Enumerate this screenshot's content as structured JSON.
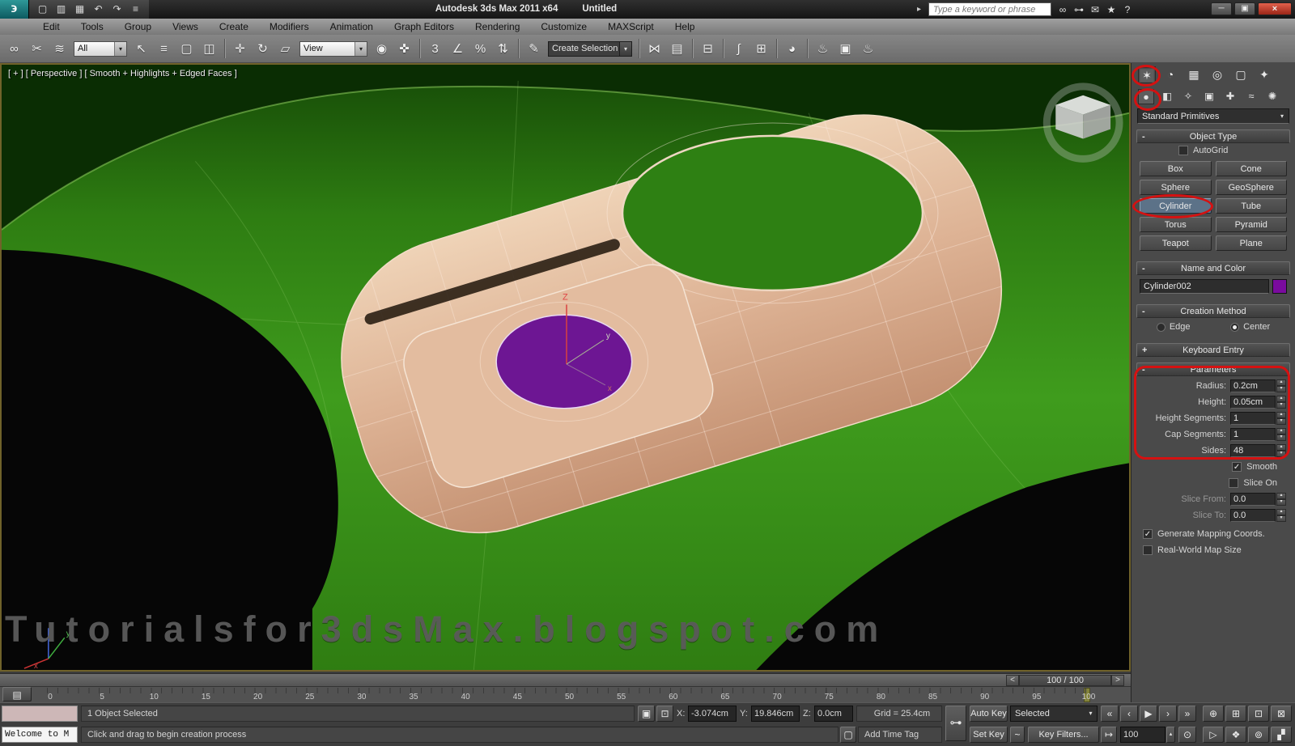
{
  "title_bar": {
    "logo_glyph": "϶",
    "app_title": "Autodesk 3ds Max  2011 x64",
    "document_title": "Untitled",
    "quick_access": [
      {
        "name": "new-scene-icon",
        "glyph": "▢"
      },
      {
        "name": "open-file-icon",
        "glyph": "▥"
      },
      {
        "name": "save-file-icon",
        "glyph": "▦"
      },
      {
        "name": "undo-icon",
        "glyph": "↶"
      },
      {
        "name": "redo-icon",
        "glyph": "↷"
      },
      {
        "name": "project-folder-icon",
        "glyph": "≡"
      }
    ],
    "search": {
      "placeholder": "Type a keyword or phrase"
    },
    "infocenter_icons": [
      {
        "name": "search-binoculars-icon",
        "glyph": "∞"
      },
      {
        "name": "subscription-key-icon",
        "glyph": "⊶"
      },
      {
        "name": "communication-center-icon",
        "glyph": "✉"
      },
      {
        "name": "favorites-star-icon",
        "glyph": "★"
      },
      {
        "name": "help-icon",
        "glyph": "?"
      }
    ],
    "window_buttons": [
      {
        "name": "minimize-button",
        "glyph": "─"
      },
      {
        "name": "restore-button",
        "glyph": "▣"
      },
      {
        "name": "close-button",
        "glyph": "×"
      }
    ]
  },
  "menu_bar": {
    "items": [
      "Edit",
      "Tools",
      "Group",
      "Views",
      "Create",
      "Modifiers",
      "Animation",
      "Graph Editors",
      "Rendering",
      "Customize",
      "MAXScript",
      "Help"
    ]
  },
  "toolbar": {
    "items": [
      {
        "name": "select-and-link-icon",
        "glyph": "∞"
      },
      {
        "name": "unlink-selection-icon",
        "glyph": "✂"
      },
      {
        "name": "bind-to-space-warp-icon",
        "glyph": "≋"
      },
      {
        "name": "selection-filter-dropdown",
        "value": "All",
        "w": "w66"
      },
      {
        "name": "select-object-icon",
        "glyph": "↖"
      },
      {
        "name": "select-by-name-icon",
        "glyph": "≡"
      },
      {
        "name": "rectangular-selection-region-icon",
        "glyph": "▢"
      },
      {
        "name": "window-crossing-icon",
        "glyph": "◫"
      },
      {
        "name": "toolbar-separator",
        "sep": true
      },
      {
        "name": "select-and-move-icon",
        "glyph": "✛"
      },
      {
        "name": "select-and-rotate-icon",
        "glyph": "↻"
      },
      {
        "name": "select-and-scale-icon",
        "glyph": "▱"
      },
      {
        "name": "reference-coordinate-dropdown",
        "value": "View",
        "w": "w84"
      },
      {
        "name": "use-pivot-point-center-icon",
        "glyph": "◉"
      },
      {
        "name": "select-and-manipulate-icon",
        "glyph": "✜"
      },
      {
        "name": "toolbar-separator",
        "sep": true
      },
      {
        "name": "snaps-toggle-icon",
        "glyph": "3"
      },
      {
        "name": "angle-snap-icon",
        "glyph": "∠"
      },
      {
        "name": "percent-snap-icon",
        "glyph": "%"
      },
      {
        "name": "spinner-snap-icon",
        "glyph": "⇅"
      },
      {
        "name": "toolbar-separator",
        "sep": true
      },
      {
        "name": "edit-named-selection-sets-icon",
        "glyph": "✎"
      },
      {
        "name": "named-selection-set-dropdown",
        "value": "Create Selection Se",
        "dark": true
      },
      {
        "name": "toolbar-separator",
        "sep": true
      },
      {
        "name": "mirror-icon",
        "glyph": "⋈"
      },
      {
        "name": "align-icon",
        "glyph": "▤"
      },
      {
        "name": "toolbar-separator",
        "sep": true
      },
      {
        "name": "layer-manager-icon",
        "glyph": "⊟"
      },
      {
        "name": "toolbar-separator",
        "sep": true
      },
      {
        "name": "graph-editors-icon",
        "glyph": "∫"
      },
      {
        "name": "schematic-view-icon",
        "glyph": "⊞"
      },
      {
        "name": "toolbar-separator",
        "sep": true
      },
      {
        "name": "material-editor-icon",
        "glyph": "◕"
      },
      {
        "name": "toolbar-separator",
        "sep": true
      },
      {
        "name": "render-setup-icon",
        "glyph": "♨"
      },
      {
        "name": "rendered-frame-window-icon",
        "glyph": "▣"
      },
      {
        "name": "render-production-icon",
        "glyph": "♨"
      }
    ]
  },
  "viewport": {
    "label": "[ + ] [ Perspective ] [ Smooth + Highlights + Edged Faces ]",
    "watermark": "Tutorialsfor3dsMax.blogspot.com",
    "gizmo_axes": {
      "z": "Z",
      "y": "y",
      "x": "x"
    }
  },
  "command_panel": {
    "tabs": [
      {
        "name": "create-tab-icon",
        "glyph": "✶",
        "selected": true
      },
      {
        "name": "modify-tab-icon",
        "glyph": "◔"
      },
      {
        "name": "hierarchy-tab-icon",
        "glyph": "▦"
      },
      {
        "name": "motion-tab-icon",
        "glyph": "◎"
      },
      {
        "name": "display-tab-icon",
        "glyph": "▢"
      },
      {
        "name": "utilities-tab-icon",
        "glyph": "✦"
      }
    ],
    "create_sub_tabs": [
      {
        "name": "geometry-icon",
        "glyph": "●",
        "selected": true
      },
      {
        "name": "shapes-icon",
        "glyph": "◧"
      },
      {
        "name": "lights-icon",
        "glyph": "✧"
      },
      {
        "name": "cameras-icon",
        "glyph": "▣"
      },
      {
        "name": "helpers-icon",
        "glyph": "✚"
      },
      {
        "name": "space-warps-icon",
        "glyph": "≈"
      },
      {
        "name": "systems-icon",
        "glyph": "✺"
      }
    ],
    "category_dropdown": "Standard Primitives",
    "object_type": {
      "title": "Object Type",
      "autogrid_label": "AutoGrid",
      "autogrid_checked": false,
      "buttons": [
        "Box",
        "Cone",
        "Sphere",
        "GeoSphere",
        "Cylinder",
        "Tube",
        "Torus",
        "Pyramid",
        "Teapot",
        "Plane"
      ],
      "active": "Cylinder"
    },
    "name_and_color": {
      "title": "Name and Color",
      "object_name": "Cylinder002",
      "color_swatch": "#7a0b9e"
    },
    "creation_method": {
      "title": "Creation Method",
      "options": [
        "Edge",
        "Center"
      ],
      "selected": "Center"
    },
    "keyboard_entry": {
      "title": "Keyboard Entry"
    },
    "parameters": {
      "title": "Parameters",
      "fields": [
        {
          "label": "Radius:",
          "value": "0.2cm"
        },
        {
          "label": "Height:",
          "value": "0.05cm"
        },
        {
          "label": "Height Segments:",
          "value": "1"
        },
        {
          "label": "Cap Segments:",
          "value": "1"
        },
        {
          "label": "Sides:",
          "value": "48"
        }
      ],
      "smooth_label": "Smooth",
      "smooth_checked": true,
      "slice_on_label": "Slice On",
      "slice_on_checked": false,
      "slice_fields": [
        {
          "label": "Slice From:",
          "value": "0.0"
        },
        {
          "label": "Slice To:",
          "value": "0.0"
        }
      ],
      "generate_mapping_label": "Generate Mapping Coords.",
      "generate_mapping_checked": true,
      "real_world_label": "Real-World Map Size",
      "real_world_checked": false
    }
  },
  "timeline": {
    "slider_label": "100 / 100",
    "prev_glyph": "<",
    "next_glyph": ">",
    "trackbar_glyph": "▤",
    "ticks": [
      "0",
      "5",
      "10",
      "15",
      "20",
      "25",
      "30",
      "35",
      "40",
      "45",
      "50",
      "55",
      "60",
      "65",
      "70",
      "75",
      "80",
      "85",
      "90",
      "95",
      "100"
    ]
  },
  "status_bar": {
    "listener_text": "Welcome to M",
    "selection_status": "1 Object Selected",
    "prompt": "Click and drag to begin creation process",
    "lock_glyph": "▣",
    "absolute_mode_glyph": "⊡",
    "isolate_glyph": "▢",
    "coord_x_label": "X:",
    "coord_x": "-3.074cm",
    "coord_y_label": "Y:",
    "coord_y": "19.846cm",
    "coord_z_label": "Z:",
    "coord_z": "0.0cm",
    "grid_text": "Grid = 25.4cm",
    "add_time_tag": "Add Time Tag",
    "key_icon_glyph": "⊶",
    "auto_key_label": "Auto Key",
    "set_key_label": "Set Key",
    "key_mode_dropdown": "Selected",
    "curve_glyph": "~",
    "key_filters_label": "Key Filters...",
    "key_step_glyph": "↦",
    "frame_field": "100",
    "time_config_glyph": "⊙",
    "playback": [
      {
        "name": "go-to-start-icon",
        "glyph": "«"
      },
      {
        "name": "previous-frame-icon",
        "glyph": "‹"
      },
      {
        "name": "play-icon",
        "glyph": "▶"
      },
      {
        "name": "next-frame-icon",
        "glyph": "›"
      },
      {
        "name": "go-to-end-icon",
        "glyph": "»"
      }
    ],
    "nav_icons_row1": [
      {
        "name": "zoom-icon",
        "glyph": "⊕"
      },
      {
        "name": "zoom-all-icon",
        "glyph": "⊞"
      },
      {
        "name": "zoom-extents-icon",
        "glyph": "⊡"
      },
      {
        "name": "zoom-extents-all-icon",
        "glyph": "⊠"
      }
    ],
    "nav_icons_row2": [
      {
        "name": "field-of-view-icon",
        "glyph": "▷"
      },
      {
        "name": "pan-icon",
        "glyph": "❖"
      },
      {
        "name": "orbit-icon",
        "glyph": "⊚"
      },
      {
        "name": "maximize-viewport-toggle-icon",
        "glyph": "▞"
      }
    ]
  },
  "glyphs": {
    "check": "✓",
    "dropdown_arrow": "▾",
    "spinner_up": "▴",
    "spinner_down": "▾",
    "rollout_expanded": "-",
    "rollout_collapsed": "+"
  },
  "colors": {
    "annotation_red": "#d51111",
    "object_purple": "#7a0b9e",
    "viewport_green": "#3f9c1d",
    "tab_tan": "#ddb294"
  }
}
